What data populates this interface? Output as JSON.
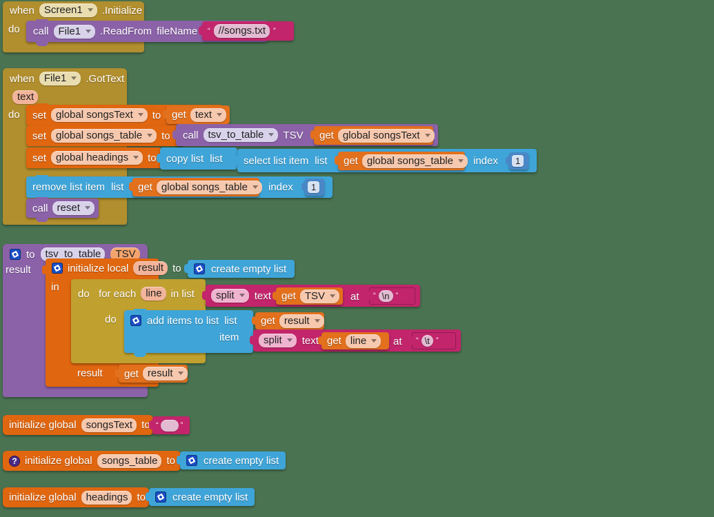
{
  "app": {
    "environment": "MIT App Inventor Blocks Editor",
    "canvas_background": "#4a7351"
  },
  "blocks": {
    "screen_init": {
      "when": "when",
      "component": "Screen1",
      "event": ".Initialize",
      "do": "do",
      "call": "call",
      "call_component": "File1",
      "method": ".ReadFrom",
      "arg_label": "fileName",
      "string_value": "//songs.txt"
    },
    "got_text": {
      "when": "when",
      "component": "File1",
      "event": ".GotText",
      "param": "text",
      "do": "do",
      "row1": {
        "set": "set",
        "variable": "global songsText",
        "to": "to",
        "get": "get",
        "get_var": "text"
      },
      "row2": {
        "set": "set",
        "variable": "global songs_table",
        "to": "to",
        "call": "call",
        "procedure": "tsv_to_table",
        "arg_label": "TSV",
        "get": "get",
        "get_var": "global songsText"
      },
      "row3": {
        "set": "set",
        "variable": "global headings",
        "to": "to",
        "copy_list": "copy list",
        "copy_list_arg": "list",
        "select_list_item": "select list item",
        "select_list_arg": "list",
        "get": "get",
        "get_var": "global songs_table",
        "index_label": "index",
        "index_value": "1"
      },
      "row4": {
        "remove_list_item": "remove list item",
        "list_label": "list",
        "get": "get",
        "get_var": "global songs_table",
        "index_label": "index",
        "index_value": "1"
      },
      "row5": {
        "call": "call",
        "procedure": "reset"
      }
    },
    "proc_tsv_to_table": {
      "to": "to",
      "name": "tsv_to_table",
      "param": "TSV",
      "result_label": "result",
      "init_local": "initialize local",
      "local_name": "result",
      "to2": "to",
      "create_empty_list": "create empty list",
      "in_label": "in",
      "do_label": "do",
      "for_each": "for each",
      "loop_var": "line",
      "in_list": "in list",
      "split1": {
        "op": "split",
        "text_label": "text",
        "get": "get",
        "get_var": "TSV",
        "at_label": "at",
        "at_value": "\\n"
      },
      "inner_do": "do",
      "add_items": "add items to list",
      "add_list_label": "list",
      "add_get": "get",
      "add_get_var": "result",
      "item_label": "item",
      "split2": {
        "op": "split",
        "text_label": "text",
        "get": "get",
        "get_var": "line",
        "at_label": "at",
        "at_value": "\\t"
      },
      "result_foot_label": "result",
      "result_get": "get",
      "result_get_var": "result"
    },
    "global_songs_text": {
      "init": "initialize global",
      "name": "songsText",
      "to": "to",
      "value": ""
    },
    "global_songs_table": {
      "help": "?",
      "init": "initialize global",
      "name": "songs_table",
      "to": "to",
      "value": "create empty list"
    },
    "global_headings": {
      "init": "initialize global",
      "name": "headings",
      "to": "to",
      "value": "create empty list"
    }
  }
}
